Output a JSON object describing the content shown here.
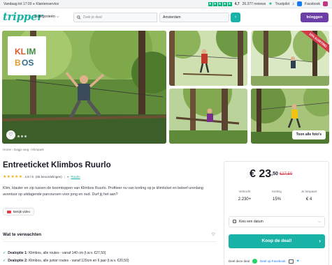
{
  "topbar": {
    "left_text": "Vandaag tot 17:00",
    "left_service": "Klantenservice",
    "trustpilot_score": "4,7",
    "trustpilot_reviews": "26.377 reviews",
    "trustpilot_brand": "Trustpilot",
    "facebook_label": "Facebook"
  },
  "header": {
    "logo": "tripper",
    "categories_label": "Categorieën",
    "search_placeholder": "Zoek je deal",
    "location_value": "Amsterdam",
    "login_label": "Inloggen"
  },
  "gallery": {
    "logo_letters": "KLIMBOS",
    "ribbon": "10% KORTING",
    "show_all_label": "Toon alle foto's"
  },
  "breadcrumb": {
    "items": [
      "Home",
      "Dagje weg",
      "Klimpark"
    ]
  },
  "deal": {
    "title": "Entreeticket Klimbos Ruurlo",
    "rating_value": "4.9 / 5",
    "rating_count": "(65 beoordelingen)",
    "location": "Ruurlo",
    "description": "Klim, klauter en zip tussen de boomtoppen van Klimbos Ruurlo. Profiteer nu van korting op je klimticket en beleef urenlang avontuur op uitdagende parcoursen voor jong en oud. Durf jij het aan?",
    "video_label": "Bekijk video"
  },
  "expect": {
    "heading": "Wat te verwachten",
    "options": [
      {
        "label": "Dealoptie 1:",
        "text": "Klimbos, alle routes - vanaf 140 cm (t.w.v. €27,50)"
      },
      {
        "label": "Dealoptie 2:",
        "text": "Klimbos, alle junior routes - vanaf 120cm en 6 jaar (t.w.v. €20,50)"
      }
    ]
  },
  "price_panel": {
    "price_main": "€ 23",
    "price_cents": ",50",
    "price_old": "€27,50",
    "stats": [
      {
        "label": "Verkocht",
        "value": "2.230+"
      },
      {
        "label": "Korting",
        "value": "15%"
      },
      {
        "label": "Je bespaart",
        "value": "€ 4"
      }
    ],
    "date_placeholder": "Kies een datum",
    "buy_label": "Koop de deal!",
    "share_label": "Deel deze deal",
    "share_facebook": "Deel op Facebook"
  },
  "colors": {
    "brand_teal": "#19b2a6",
    "login_purple": "#6c3fa6",
    "discount_red": "#d33a4a",
    "trustpilot_green": "#00b67a",
    "star_yellow": "#f2b01e"
  }
}
